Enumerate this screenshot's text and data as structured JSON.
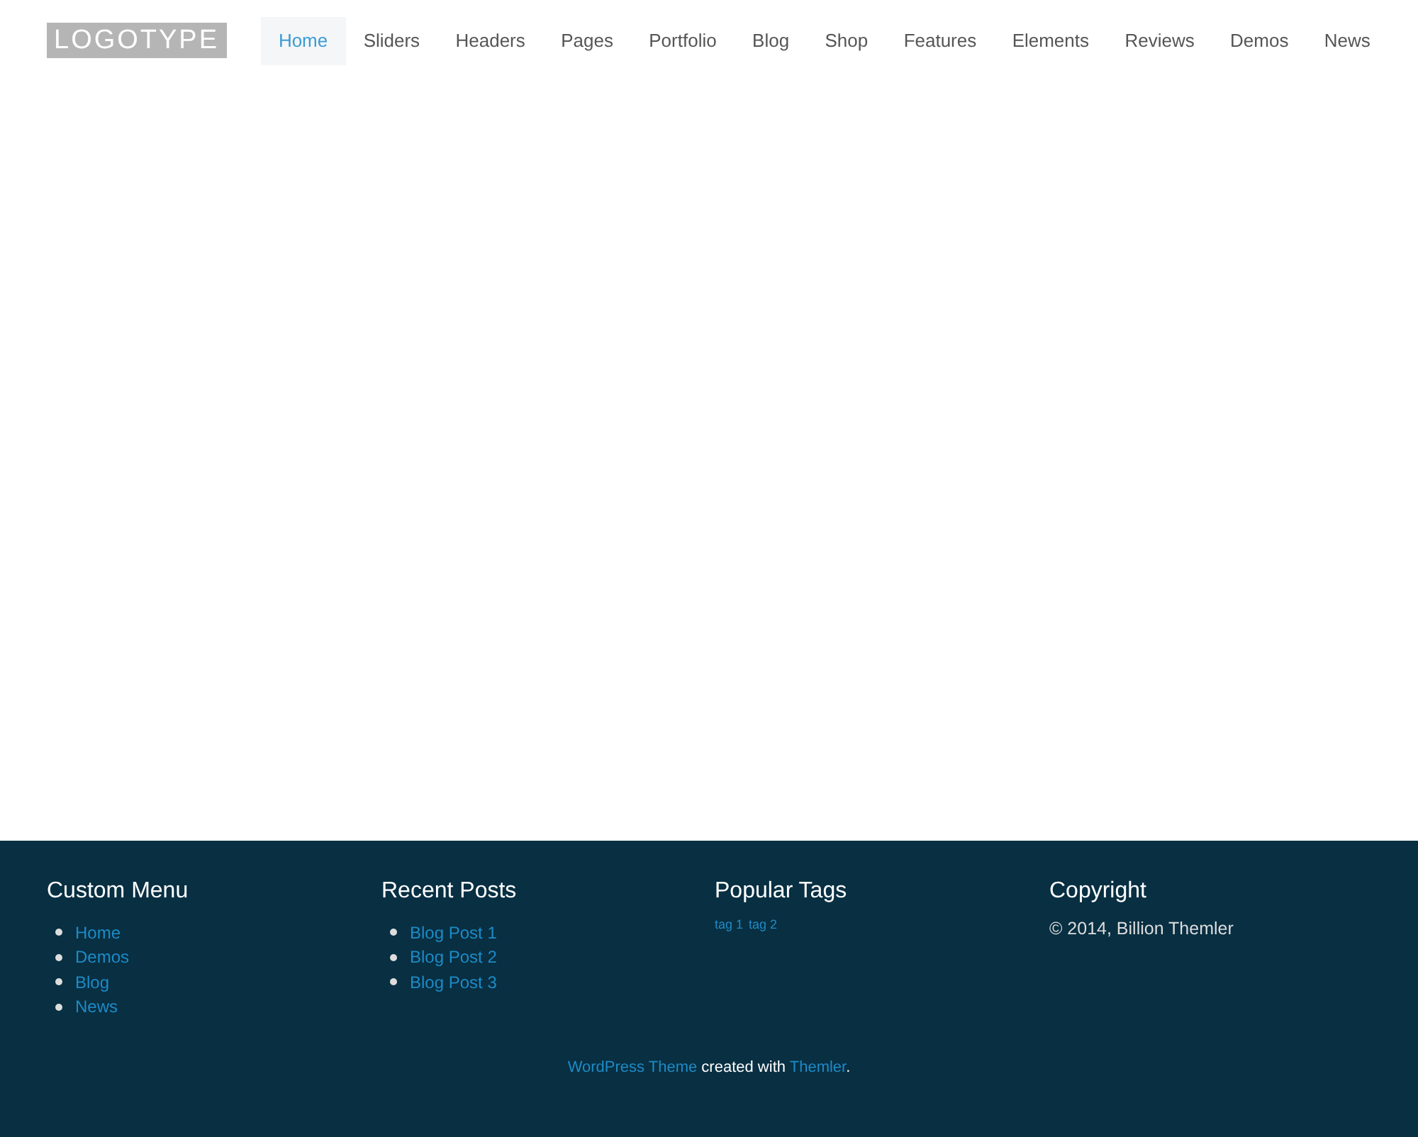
{
  "logo": "LOGOTYPE",
  "nav": [
    {
      "label": "Home",
      "selected": true
    },
    {
      "label": "Sliders",
      "selected": false
    },
    {
      "label": "Headers",
      "selected": false
    },
    {
      "label": "Pages",
      "selected": false
    },
    {
      "label": "Portfolio",
      "selected": false
    },
    {
      "label": "Blog",
      "selected": false
    },
    {
      "label": "Shop",
      "selected": false
    },
    {
      "label": "Features",
      "selected": false
    },
    {
      "label": "Elements",
      "selected": false
    },
    {
      "label": "Reviews",
      "selected": false
    },
    {
      "label": "Demos",
      "selected": false
    },
    {
      "label": "News",
      "selected": false
    }
  ],
  "footer": {
    "columns": [
      {
        "kind": "list",
        "title": "Custom Menu",
        "items": [
          "Home",
          "Demos",
          "Blog",
          "News"
        ]
      },
      {
        "kind": "list",
        "title": "Recent Posts",
        "items": [
          "Blog Post 1",
          "Blog Post 2",
          "Blog Post 3"
        ]
      },
      {
        "kind": "tags",
        "title": "Popular Tags",
        "items": [
          "tag 1",
          "tag 2"
        ]
      },
      {
        "kind": "text",
        "title": "Copyright",
        "text": "© 2014, Billion Themler"
      }
    ],
    "credit": {
      "link": "WordPress Theme",
      "middle": "created with",
      "link2": "Themler",
      "end": "."
    }
  }
}
